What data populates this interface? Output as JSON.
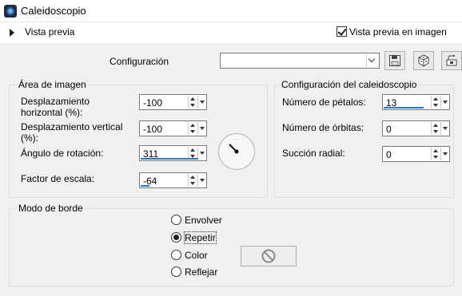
{
  "window": {
    "title": "Caleidoscopio"
  },
  "preview": {
    "label": "Vista previa",
    "checkbox_label": "Vista previa en imagen",
    "checked": true
  },
  "config": {
    "label": "Configuración",
    "value": ""
  },
  "image_area": {
    "title": "Área de imagen",
    "fields": [
      {
        "label": "Desplazamiento horizontal (%):",
        "value": "-100"
      },
      {
        "label": "Desplazamiento vertical (%):",
        "value": "-100"
      },
      {
        "label": "Ángulo de rotación:",
        "value": "311"
      },
      {
        "label": "Factor de escala:",
        "value": "-64"
      }
    ]
  },
  "kaleido": {
    "title": "Configuración del caleidoscopio",
    "fields": [
      {
        "label": "Número de pétalos:",
        "value": "13"
      },
      {
        "label": "Número de órbitas:",
        "value": "0"
      },
      {
        "label": "Succión radial:",
        "value": "0"
      }
    ]
  },
  "edge_mode": {
    "title": "Modo de borde",
    "options": [
      "Envolver",
      "Repetir",
      "Color",
      "Reflejar"
    ],
    "selected": "Repetir"
  },
  "colors": {
    "accent": "#1e79c9",
    "background": "#f0f0f0"
  },
  "icons": [
    "app-icon",
    "expand-triangle-icon",
    "save-icon",
    "random-dice-icon",
    "reset-icon",
    "rotation-dial-icon",
    "no-color-icon"
  ]
}
